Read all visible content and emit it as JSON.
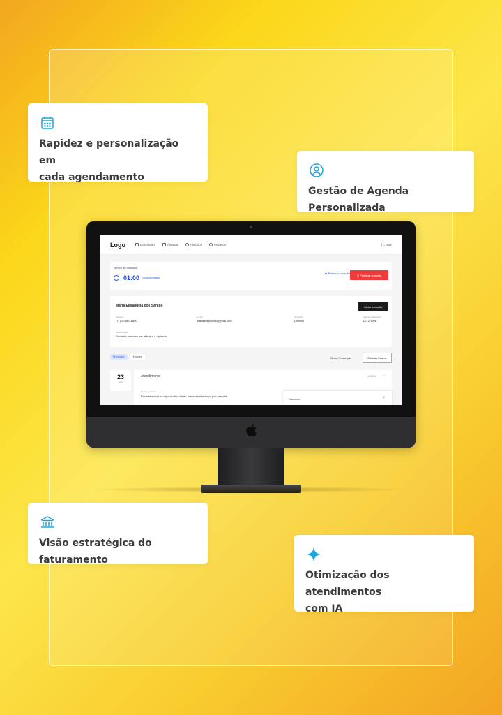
{
  "features": [
    {
      "icon": "calendar-icon",
      "text_line1": "Rapidez e personalização em",
      "text_line2": "cada agendamento"
    },
    {
      "icon": "user-circle-icon",
      "text_line1": "Gestão de Agenda Personalizada"
    },
    {
      "icon": "bank-icon",
      "text_line1": "Visão estratégica do faturamento"
    },
    {
      "icon": "sparkle-icon",
      "text_line1": "Otimização dos atendimentos",
      "text_line2": "com IA"
    }
  ],
  "colors": {
    "accent_icon": "#1aa6df",
    "primary": "#1d4ed8",
    "danger": "#ef3b3b"
  },
  "app": {
    "logo": "Logo",
    "nav": [
      "Dashboard",
      "Agenda",
      "Histórico",
      "Modelos"
    ],
    "logout": "Sair",
    "consult": {
      "label": "Tempo de consulta",
      "time": "01:00",
      "status": "Consulta pausada",
      "resume": "Retomar consulta",
      "finish": "Finalizar consulta"
    },
    "patient": {
      "name": "Maria Elisângela dos Santos",
      "start_button": "Iniciar consulta",
      "phone_label": "Telefone",
      "phone": "(71) 9 0860-8860",
      "email_label": "E-mail",
      "email": "mariadossantos@gmail.com",
      "plan_label": "Convênio",
      "plan": "Unimed",
      "birth_label": "Data de nascimento",
      "birth": "12/12/1998",
      "notes_label": "Observações",
      "notes": "Paciente informou ser alérgico à dipirona."
    },
    "tabs": [
      "Prontuário",
      "Exames"
    ],
    "prescription_button": "Gerar Prescrição",
    "exam_button": "Solicitar Exame",
    "record": {
      "day": "23",
      "month": "Julho",
      "title": "Atendimento",
      "time": "23:00",
      "complaint_label": "Queixa principal",
      "complaint": "Dor abdominal no hipocôndrio direito, náuseas e inchaço pós prandial."
    },
    "popup": {
      "label": "Cameron",
      "close": "×"
    }
  }
}
